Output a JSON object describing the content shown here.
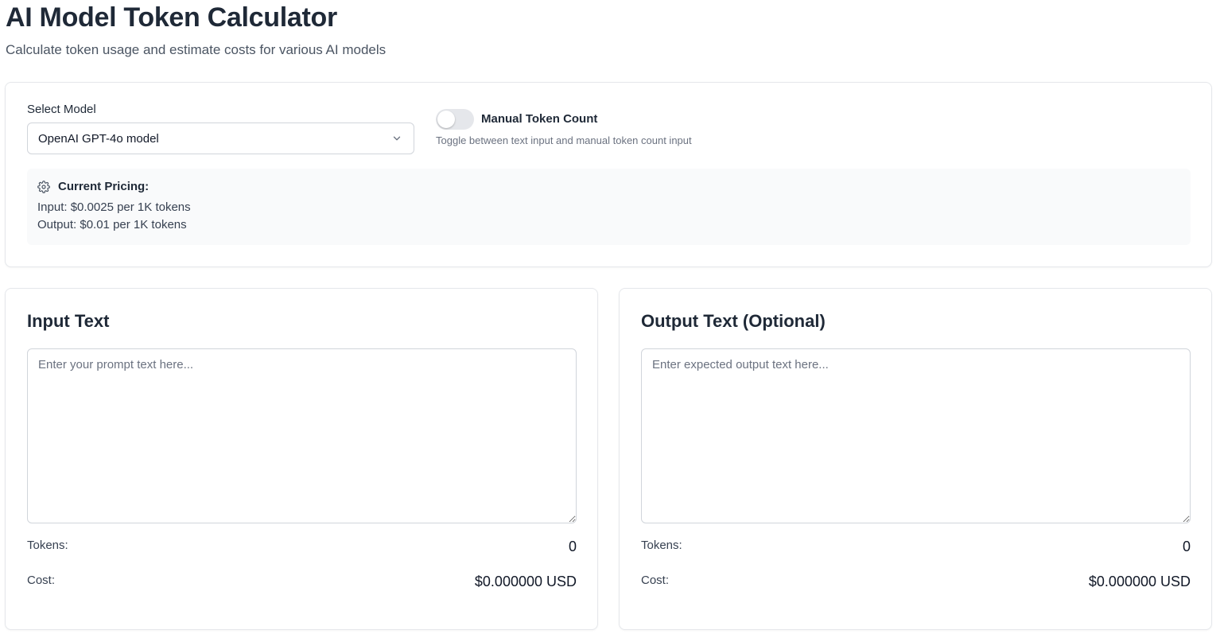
{
  "header": {
    "title": "AI Model Token Calculator",
    "subtitle": "Calculate token usage and estimate costs for various AI models"
  },
  "settings": {
    "model_label": "Select Model",
    "model_selected": "OpenAI GPT-4o model",
    "manual_toggle": {
      "label": "Manual Token Count",
      "help": "Toggle between text input and manual token count input",
      "enabled": false
    },
    "pricing": {
      "heading": "Current Pricing:",
      "input_line": "Input: $0.0025 per 1K tokens",
      "output_line": "Output: $0.01 per 1K tokens"
    }
  },
  "input_panel": {
    "title": "Input Text",
    "placeholder": "Enter your prompt text here...",
    "tokens_label": "Tokens:",
    "tokens_value": "0",
    "cost_label": "Cost:",
    "cost_value": "$0.000000 USD"
  },
  "output_panel": {
    "title": "Output Text (Optional)",
    "placeholder": "Enter expected output text here...",
    "tokens_label": "Tokens:",
    "tokens_value": "0",
    "cost_label": "Cost:",
    "cost_value": "$0.000000 USD"
  },
  "icons": {
    "select_caret": "chevron-down-icon",
    "pricing_icon": "gear-icon"
  }
}
